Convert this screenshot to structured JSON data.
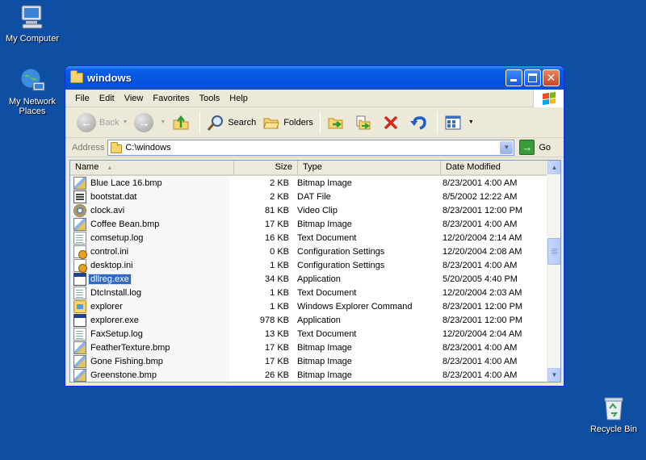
{
  "desktop": {
    "icons": [
      {
        "label": "My Computer",
        "icon": "computer-icon"
      },
      {
        "label": "My Network Places",
        "icon": "network-places-icon"
      },
      {
        "label": "Recycle Bin",
        "icon": "recycle-bin-icon"
      }
    ]
  },
  "window": {
    "title": "windows",
    "menu": [
      "File",
      "Edit",
      "View",
      "Favorites",
      "Tools",
      "Help"
    ],
    "toolbar": {
      "back_label": "Back",
      "search_label": "Search",
      "folders_label": "Folders"
    },
    "address": {
      "label": "Address",
      "value": "C:\\windows",
      "go_label": "Go"
    },
    "columns": [
      "Name",
      "Size",
      "Type",
      "Date Modified"
    ],
    "files": [
      {
        "name": "Blue Lace 16.bmp",
        "size": "2 KB",
        "type": "Bitmap Image",
        "date": "8/23/2001 4:00 AM",
        "icon": "bmp"
      },
      {
        "name": "bootstat.dat",
        "size": "2 KB",
        "type": "DAT File",
        "date": "8/5/2002 12:22 AM",
        "icon": "dat"
      },
      {
        "name": "clock.avi",
        "size": "81 KB",
        "type": "Video Clip",
        "date": "8/23/2001 12:00 PM",
        "icon": "avi"
      },
      {
        "name": "Coffee Bean.bmp",
        "size": "17 KB",
        "type": "Bitmap Image",
        "date": "8/23/2001 4:00 AM",
        "icon": "bmp"
      },
      {
        "name": "comsetup.log",
        "size": "16 KB",
        "type": "Text Document",
        "date": "12/20/2004 2:14 AM",
        "icon": "txt"
      },
      {
        "name": "control.ini",
        "size": "0 KB",
        "type": "Configuration Settings",
        "date": "12/20/2004 2:08 AM",
        "icon": "ini"
      },
      {
        "name": "desktop.ini",
        "size": "1 KB",
        "type": "Configuration Settings",
        "date": "8/23/2001 4:00 AM",
        "icon": "ini"
      },
      {
        "name": "dllreg.exe",
        "size": "34 KB",
        "type": "Application",
        "date": "5/20/2005 4:40 PM",
        "icon": "exe",
        "selected": true
      },
      {
        "name": "DtcInstall.log",
        "size": "1 KB",
        "type": "Text Document",
        "date": "12/20/2004 2:03 AM",
        "icon": "txt"
      },
      {
        "name": "explorer",
        "size": "1 KB",
        "type": "Windows Explorer Command",
        "date": "8/23/2001 12:00 PM",
        "icon": "scf"
      },
      {
        "name": "explorer.exe",
        "size": "978 KB",
        "type": "Application",
        "date": "8/23/2001 12:00 PM",
        "icon": "exe"
      },
      {
        "name": "FaxSetup.log",
        "size": "13 KB",
        "type": "Text Document",
        "date": "12/20/2004 2:04 AM",
        "icon": "txt"
      },
      {
        "name": "FeatherTexture.bmp",
        "size": "17 KB",
        "type": "Bitmap Image",
        "date": "8/23/2001 4:00 AM",
        "icon": "bmp"
      },
      {
        "name": "Gone Fishing.bmp",
        "size": "17 KB",
        "type": "Bitmap Image",
        "date": "8/23/2001 4:00 AM",
        "icon": "bmp"
      },
      {
        "name": "Greenstone.bmp",
        "size": "26 KB",
        "type": "Bitmap Image",
        "date": "8/23/2001 4:00 AM",
        "icon": "bmp"
      }
    ]
  },
  "colors": {
    "desktop": "#0e4ea3",
    "titlebar": "#0553e1",
    "selection": "#316ac5"
  }
}
